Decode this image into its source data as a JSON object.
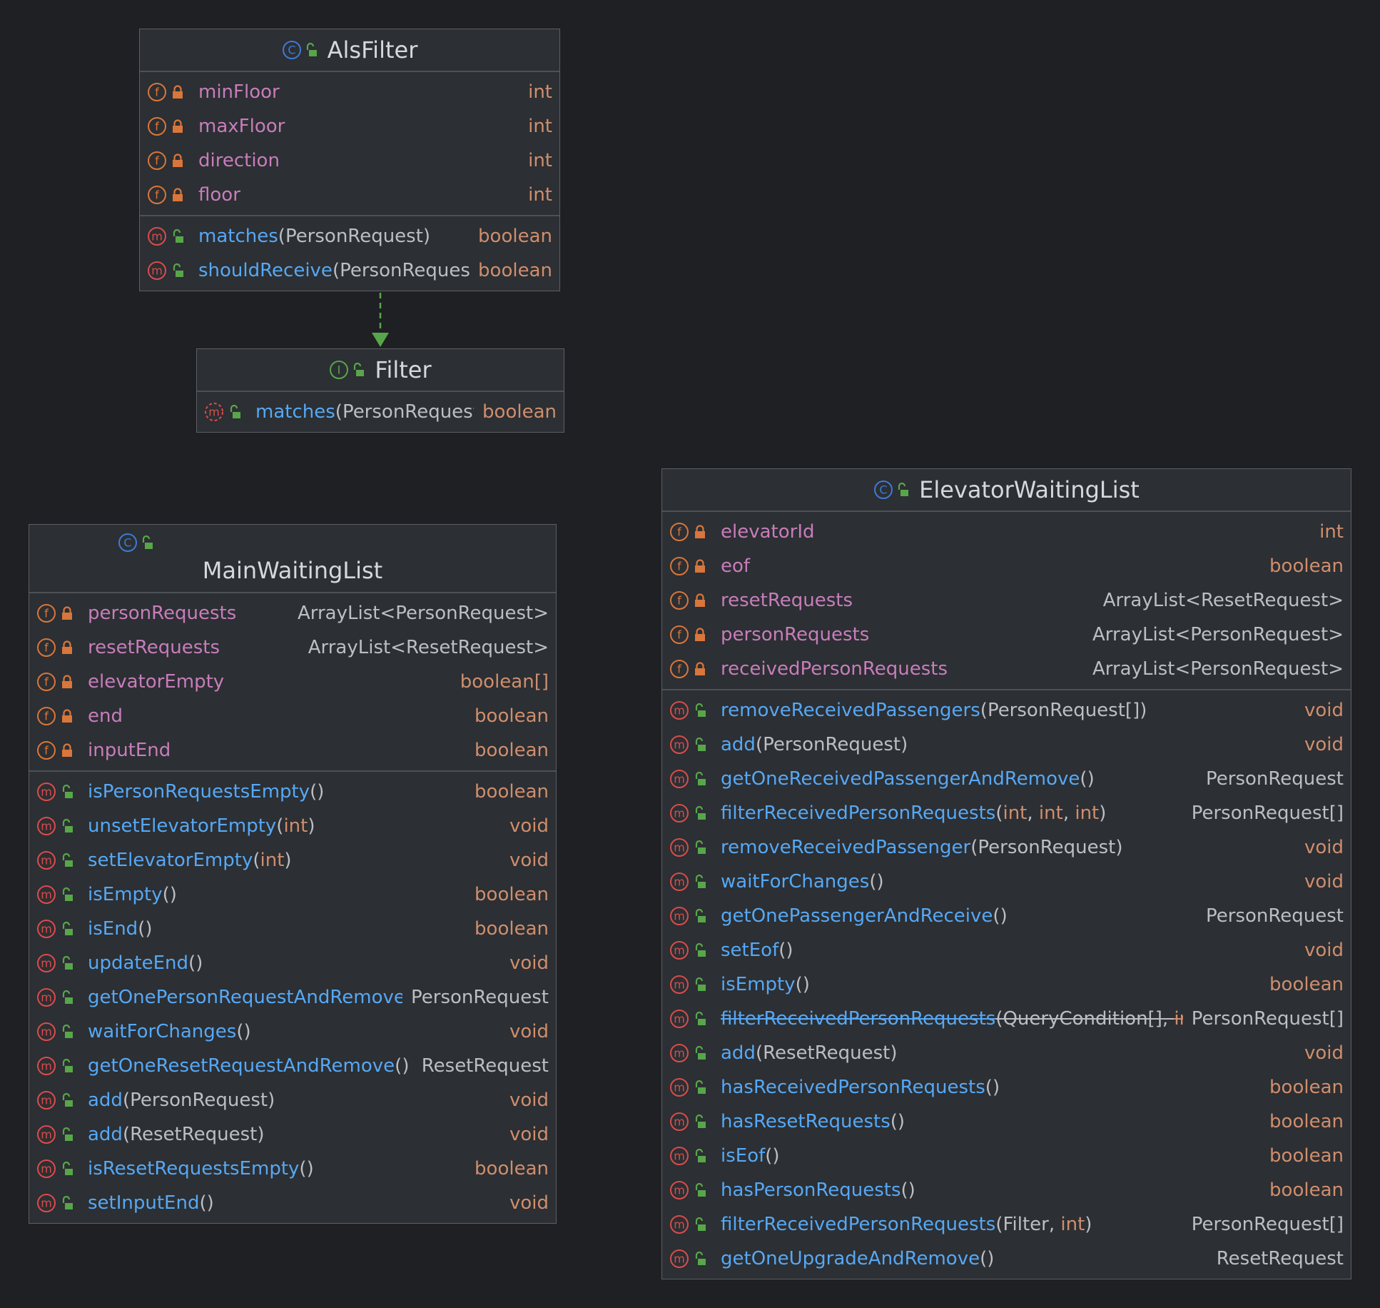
{
  "colors": {
    "background": "#1f2023",
    "box": "#2c2f33",
    "field": "#c77dbb",
    "method": "#56a8f5",
    "keyword": "#cf8e6d",
    "type": "#bcbec4",
    "class_icon": "#3d7ad6",
    "interface_icon": "#57a64a",
    "field_icon": "#d9763b",
    "method_icon": "#d94c4c"
  },
  "classes": [
    {
      "id": "AlsFilter",
      "kind": "class",
      "name": "AlsFilter",
      "fields": [
        {
          "name": "minFloor",
          "type": "int"
        },
        {
          "name": "maxFloor",
          "type": "int"
        },
        {
          "name": "direction",
          "type": "int"
        },
        {
          "name": "floor",
          "type": "int"
        }
      ],
      "methods": [
        {
          "name": "matches",
          "params": [
            {
              "t": "PersonRequest"
            }
          ],
          "ret": "boolean"
        },
        {
          "name": "shouldReceive",
          "params": [
            {
              "t": "PersonRequest"
            }
          ],
          "ret": "boolean"
        }
      ]
    },
    {
      "id": "Filter",
      "kind": "interface",
      "name": "Filter",
      "fields": [],
      "methods": [
        {
          "name": "matches",
          "params": [
            {
              "t": "PersonRequest"
            }
          ],
          "ret": "boolean",
          "abstract": true
        }
      ]
    },
    {
      "id": "MainWaitingList",
      "kind": "class",
      "name": "MainWaitingList",
      "fields": [
        {
          "name": "personRequests",
          "type": "ArrayList<PersonRequest>"
        },
        {
          "name": "resetRequests",
          "type": "ArrayList<ResetRequest>"
        },
        {
          "name": "elevatorEmpty",
          "type": "boolean[]"
        },
        {
          "name": "end",
          "type": "boolean"
        },
        {
          "name": "inputEnd",
          "type": "boolean"
        }
      ],
      "methods": [
        {
          "name": "isPersonRequestsEmpty",
          "params": [],
          "ret": "boolean"
        },
        {
          "name": "unsetElevatorEmpty",
          "params": [
            {
              "t": "int"
            }
          ],
          "ret": "void"
        },
        {
          "name": "setElevatorEmpty",
          "params": [
            {
              "t": "int"
            }
          ],
          "ret": "void"
        },
        {
          "name": "isEmpty",
          "params": [],
          "ret": "boolean"
        },
        {
          "name": "isEnd",
          "params": [],
          "ret": "boolean"
        },
        {
          "name": "updateEnd",
          "params": [],
          "ret": "void"
        },
        {
          "name": "getOnePersonRequestAndRemove",
          "params": [],
          "ret": "PersonRequest"
        },
        {
          "name": "waitForChanges",
          "params": [],
          "ret": "void"
        },
        {
          "name": "getOneResetRequestAndRemove",
          "params": [],
          "ret": "ResetRequest"
        },
        {
          "name": "add",
          "params": [
            {
              "t": "PersonRequest"
            }
          ],
          "ret": "void"
        },
        {
          "name": "add",
          "params": [
            {
              "t": "ResetRequest"
            }
          ],
          "ret": "void"
        },
        {
          "name": "isResetRequestsEmpty",
          "params": [],
          "ret": "boolean"
        },
        {
          "name": "setInputEnd",
          "params": [],
          "ret": "void"
        }
      ]
    },
    {
      "id": "ElevatorWaitingList",
      "kind": "class",
      "name": "ElevatorWaitingList",
      "fields": [
        {
          "name": "elevatorId",
          "type": "int"
        },
        {
          "name": "eof",
          "type": "boolean"
        },
        {
          "name": "resetRequests",
          "type": "ArrayList<ResetRequest>"
        },
        {
          "name": "personRequests",
          "type": "ArrayList<PersonRequest>"
        },
        {
          "name": "receivedPersonRequests",
          "type": "ArrayList<PersonRequest>"
        }
      ],
      "methods": [
        {
          "name": "removeReceivedPassengers",
          "params": [
            {
              "t": "PersonRequest[]"
            }
          ],
          "ret": "void"
        },
        {
          "name": "add",
          "params": [
            {
              "t": "PersonRequest"
            }
          ],
          "ret": "void"
        },
        {
          "name": "getOneReceivedPassengerAndRemove",
          "params": [],
          "ret": "PersonRequest"
        },
        {
          "name": "filterReceivedPersonRequests",
          "params": [
            {
              "t": "int"
            },
            {
              "t": "int"
            },
            {
              "t": "int"
            }
          ],
          "ret": "PersonRequest[]"
        },
        {
          "name": "removeReceivedPassenger",
          "params": [
            {
              "t": "PersonRequest"
            }
          ],
          "ret": "void"
        },
        {
          "name": "waitForChanges",
          "params": [],
          "ret": "void"
        },
        {
          "name": "getOnePassengerAndReceive",
          "params": [],
          "ret": "PersonRequest"
        },
        {
          "name": "setEof",
          "params": [],
          "ret": "void"
        },
        {
          "name": "isEmpty",
          "params": [],
          "ret": "boolean"
        },
        {
          "name": "filterReceivedPersonRequests",
          "params": [
            {
              "t": "QueryCondition[]"
            },
            {
              "t": "int"
            }
          ],
          "ret": "PersonRequest[]",
          "deprecated": true
        },
        {
          "name": "add",
          "params": [
            {
              "t": "ResetRequest"
            }
          ],
          "ret": "void"
        },
        {
          "name": "hasReceivedPersonRequests",
          "params": [],
          "ret": "boolean"
        },
        {
          "name": "hasResetRequests",
          "params": [],
          "ret": "boolean"
        },
        {
          "name": "isEof",
          "params": [],
          "ret": "boolean"
        },
        {
          "name": "hasPersonRequests",
          "params": [],
          "ret": "boolean"
        },
        {
          "name": "filterReceivedPersonRequests",
          "params": [
            {
              "t": "Filter"
            },
            {
              "t": "int"
            }
          ],
          "ret": "PersonRequest[]"
        },
        {
          "name": "getOneUpgradeAndRemove",
          "params": [],
          "ret": "ResetRequest"
        }
      ]
    }
  ],
  "relations": [
    {
      "from": "AlsFilter",
      "to": "Filter",
      "type": "implements"
    }
  ]
}
